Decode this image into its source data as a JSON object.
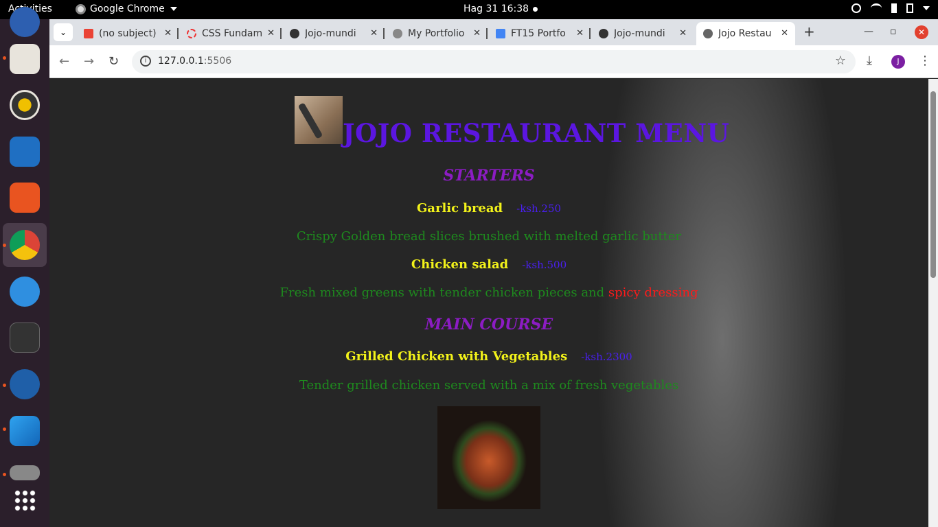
{
  "desktop": {
    "activities": "Activities",
    "app_name": "Google Chrome",
    "clock": "Hag 31  16:38"
  },
  "browser": {
    "tabs": [
      {
        "title": "(no subject)",
        "icon": "gmail-icon"
      },
      {
        "title": "CSS Fundam",
        "icon": "loading-icon"
      },
      {
        "title": "Jojo-mundi",
        "icon": "github-icon"
      },
      {
        "title": "My Portfolio",
        "icon": "globe-icon"
      },
      {
        "title": "FT15 Portfo",
        "icon": "docs-icon"
      },
      {
        "title": "Jojo-mundi",
        "icon": "github-icon"
      },
      {
        "title": "Jojo Restau",
        "icon": "globe-icon",
        "active": true
      }
    ],
    "url_host": "127.0.0.1",
    "url_port": ":5506",
    "profile_initial": "J"
  },
  "page": {
    "title": "JOJO RESTAURANT MENU",
    "starters_heading": "STARTERS",
    "main_heading": "MAIN COURSE",
    "dishes": [
      {
        "name": "Garlic bread",
        "price": "-ksh.250",
        "desc": "Crispy Golden bread slices brushed with melted garlic butter"
      },
      {
        "name": "Chicken salad",
        "price": "-ksh.500",
        "desc_a": "Fresh mixed greens with tender chicken pieces and ",
        "desc_b": "spicy dressing"
      },
      {
        "name": "Grilled Chicken with Vegetables",
        "price": "-ksh.2300",
        "desc": "Tender grilled chicken served with a mix of fresh vegetables"
      }
    ]
  }
}
